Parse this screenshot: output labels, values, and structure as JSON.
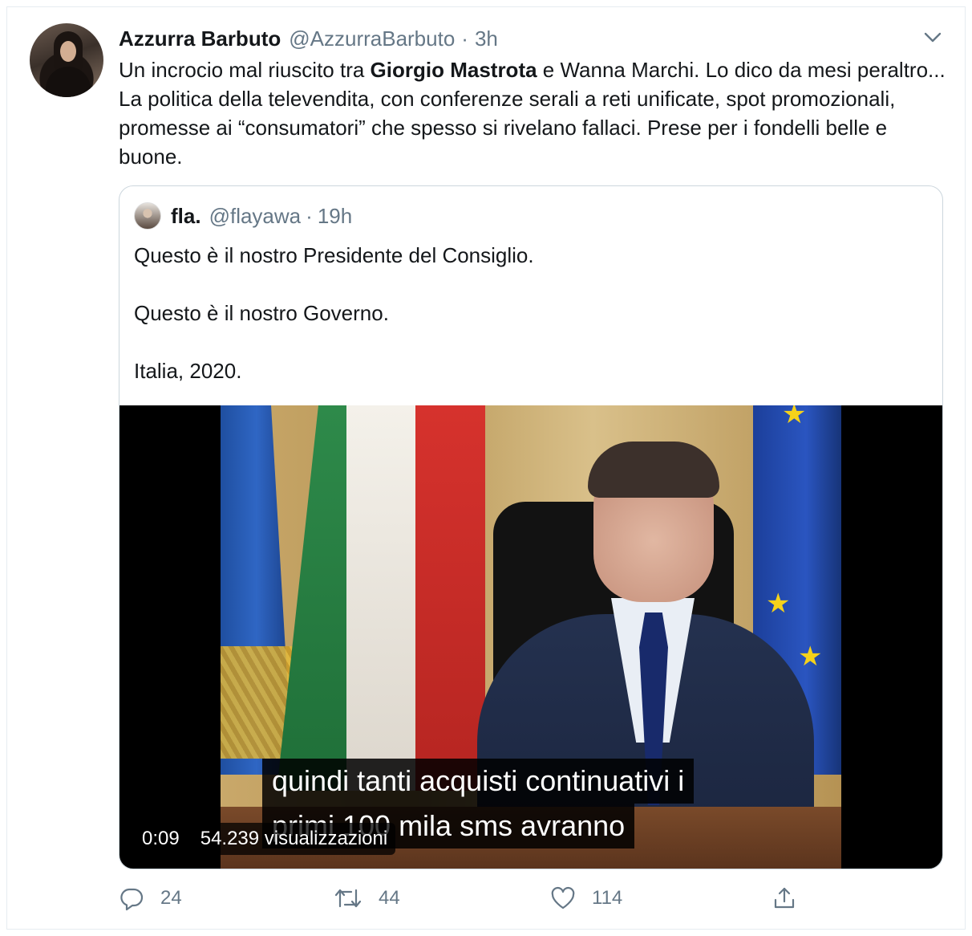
{
  "tweet": {
    "author_name": "Azzurra Barbuto",
    "author_handle": "@AzzurraBarbuto",
    "separator": "·",
    "time": "3h",
    "text_part1": "Un incrocio mal riuscito tra ",
    "text_bold": "Giorgio Mastrota",
    "text_part2": " e Wanna Marchi. Lo dico da mesi peraltro... La politica della televendita, con conferenze serali a reti unificate, spot promozionali, promesse ai “consumatori” che spesso si rivelano fallaci. Prese per i fondelli belle e buone."
  },
  "quote": {
    "author_name": "fla.",
    "author_handle": "@flayawa",
    "separator": "·",
    "time": "19h",
    "paragraphs": [
      "Questo è il nostro Presidente del Consiglio.",
      "Questo è il nostro Governo.",
      "Italia, 2020."
    ]
  },
  "video": {
    "subtitle_line1": "quindi tanti acquisti continuativi i",
    "subtitle_line2": "primi 100 mila sms avranno",
    "elapsed": "0:09",
    "views": "54.239 visualizzazioni"
  },
  "actions": {
    "reply_count": "24",
    "retweet_count": "44",
    "like_count": "114"
  },
  "icons": {
    "caret": "chevron-down-icon",
    "reply": "reply-icon",
    "retweet": "retweet-icon",
    "like": "heart-icon",
    "share": "share-icon"
  },
  "colors": {
    "text_primary": "#14171a",
    "text_secondary": "#657786",
    "border": "#ccd6dd"
  }
}
